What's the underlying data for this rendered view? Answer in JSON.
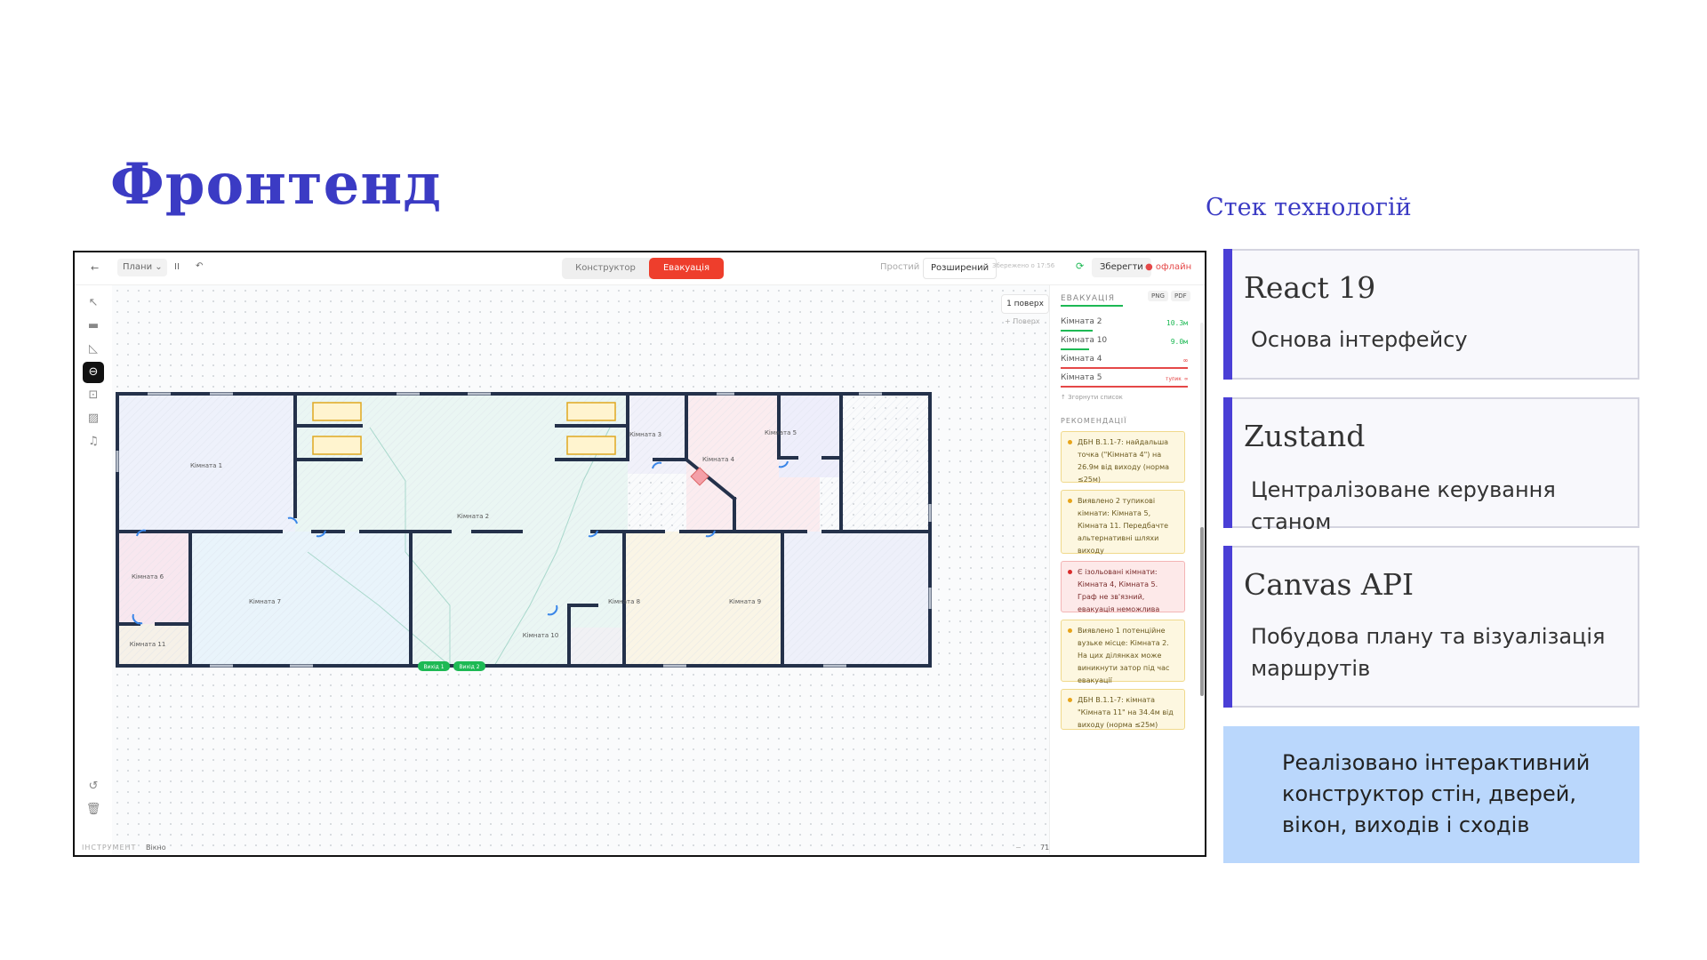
{
  "slide": {
    "title": "Фронтенд",
    "stack_label": "Стек технологій",
    "cards": [
      {
        "name": "React 19",
        "desc": "Основа інтерфейсу"
      },
      {
        "name": "Zustand",
        "desc": "Централізоване керування станом"
      },
      {
        "name": "Canvas API",
        "desc": "Побудова плану та візуалізація маршрутів"
      }
    ],
    "note": "Реалізовано інтерактивний конструктор стін, дверей, вікон, виходів і сходів"
  },
  "app": {
    "back": "←",
    "plans_menu": "Плани",
    "pause": "II",
    "undo_top": "↶",
    "mode_constructor": "Конструктор",
    "mode_evacuation": "Евакуація",
    "view_simple": "Простий",
    "view_extended": "Розширений",
    "saved_text": "Збережено о 17:56",
    "save": "Зберегти",
    "offline": "офлайн",
    "floor": "1 поверх",
    "add_floor": "+ Поверх",
    "status_label": "ІНСТРУМЕНТ",
    "status_tool": "Вікно",
    "zoom_minus": "−",
    "zoom": "71%",
    "zoom_plus": "+",
    "colors": {
      "accent": "#ee3e2c",
      "green": "#1db954",
      "red": "#e54848",
      "selected_tool": "#111111"
    }
  },
  "panel": {
    "title": "ЕВАКУАЦІЯ",
    "png": "PNG",
    "pdf": "PDF",
    "rows": [
      {
        "room": "Кімната 2",
        "value": "10.3м",
        "state": "ok"
      },
      {
        "room": "Кімната 10",
        "value": "9.0м",
        "state": "ok"
      },
      {
        "room": "Кімната 4",
        "value": "∞",
        "state": "bad"
      },
      {
        "room": "Кімната 5",
        "value": "тупик ∞",
        "state": "bad"
      }
    ],
    "collapse": "↑ Згорнути список",
    "rec_title": "РЕКОМЕНДАЦІЇ",
    "recs": [
      {
        "text": "ДБН В.1.1-7: найдальша точка (\"Кімната 4\") на 26.9м від виходу (норма ≤25м)",
        "level": "warn"
      },
      {
        "text": "Виявлено 2 тупикові кімнати: Кімната 5, Кімната 11. Передбачте альтернативні шляхи виходу",
        "level": "warn"
      },
      {
        "text": "Є ізольовані кімнати: Кімната 4, Кімната 5. Граф не зв'язний, евакуація неможлива",
        "level": "error"
      },
      {
        "text": "Виявлено 1 потенційне вузьке місце: Кімната 2. На цих ділянках може виникнути затор під час евакуації",
        "level": "warn"
      },
      {
        "text": "ДБН В.1.1-7: кімната \"Кімната 11\" на 34.4м від виходу (норма ≤25м)",
        "level": "warn"
      }
    ]
  },
  "plan": {
    "rooms": [
      "Кімната 1",
      "Кімната 2",
      "Кімната 3",
      "Кімната 4",
      "Кімната 5",
      "Кімната 6",
      "Кімната 7",
      "Кімната 8",
      "Кімната 9",
      "Кімната 10",
      "Кімната 11"
    ],
    "exits": [
      "Вихід 1",
      "Вихід 2"
    ]
  }
}
